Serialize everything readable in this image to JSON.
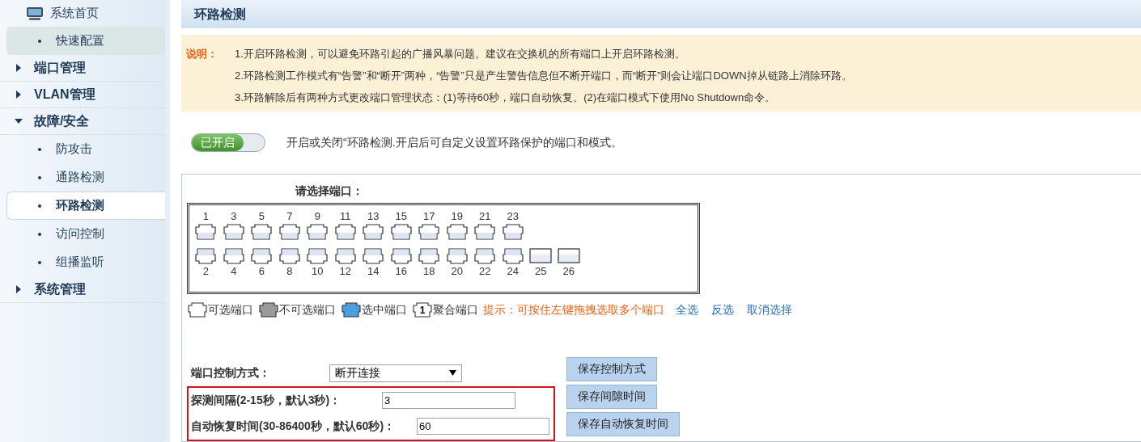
{
  "sidebar": {
    "items": [
      {
        "kind": "home",
        "label": "系统首页"
      },
      {
        "kind": "item",
        "label": "快速配置",
        "selected": false,
        "highlighted": true
      },
      {
        "kind": "group",
        "label": "端口管理",
        "expanded": false
      },
      {
        "kind": "group",
        "label": "VLAN管理",
        "expanded": false
      },
      {
        "kind": "group",
        "label": "故障/安全",
        "expanded": true,
        "children": [
          {
            "kind": "item",
            "label": "防攻击",
            "selected": false,
            "highlighted": false
          },
          {
            "kind": "item",
            "label": "通路检测",
            "selected": false,
            "highlighted": false
          },
          {
            "kind": "item",
            "label": "环路检测",
            "selected": true,
            "highlighted": false
          },
          {
            "kind": "item",
            "label": "访问控制",
            "selected": false,
            "highlighted": false
          },
          {
            "kind": "item",
            "label": "组播监听",
            "selected": false,
            "highlighted": false
          }
        ]
      },
      {
        "kind": "group",
        "label": "系统管理",
        "expanded": false
      }
    ]
  },
  "page_title": "环路检测",
  "note": {
    "label": "说明：",
    "lines": [
      "1.开启环路检测，可以避免环路引起的广播风暴问题。建议在交换机的所有端口上开启环路检测。",
      "2.环路检测工作模式有“告警”和“断开”两种，“告警”只是产生警告信息但不断开端口，而“断开”则会让端口DOWN掉从链路上消除环路。",
      "3.环路解除后有两种方式更改端口管理状态：(1)等待60秒，端口自动恢复。(2)在端口模式下使用No Shutdown命令。"
    ]
  },
  "toggle": {
    "label": "已开启",
    "on": true,
    "description": "开启或关闭“环路检测.开启后可自定义设置环路保护的端口和模式。"
  },
  "port_panel": {
    "title": "请选择端口：",
    "top_row": [
      {
        "label": "1",
        "kind": "rj45"
      },
      {
        "label": "3",
        "kind": "rj45"
      },
      {
        "label": "5",
        "kind": "rj45"
      },
      {
        "label": "7",
        "kind": "rj45"
      },
      {
        "label": "9",
        "kind": "rj45"
      },
      {
        "label": "11",
        "kind": "rj45"
      },
      {
        "label": "13",
        "kind": "rj45"
      },
      {
        "label": "15",
        "kind": "rj45"
      },
      {
        "label": "17",
        "kind": "rj45"
      },
      {
        "label": "19",
        "kind": "rj45"
      },
      {
        "label": "21",
        "kind": "rj45"
      },
      {
        "label": "23",
        "kind": "rj45"
      }
    ],
    "bottom_row": [
      {
        "label": "2",
        "kind": "rj45"
      },
      {
        "label": "4",
        "kind": "rj45"
      },
      {
        "label": "6",
        "kind": "rj45"
      },
      {
        "label": "8",
        "kind": "rj45"
      },
      {
        "label": "10",
        "kind": "rj45"
      },
      {
        "label": "12",
        "kind": "rj45"
      },
      {
        "label": "14",
        "kind": "rj45"
      },
      {
        "label": "16",
        "kind": "rj45"
      },
      {
        "label": "18",
        "kind": "rj45"
      },
      {
        "label": "20",
        "kind": "rj45"
      },
      {
        "label": "22",
        "kind": "rj45"
      },
      {
        "label": "24",
        "kind": "rj45"
      },
      {
        "label": "25",
        "kind": "sfp"
      },
      {
        "label": "26",
        "kind": "sfp"
      }
    ],
    "legend": [
      {
        "kind": "available",
        "label": "可选端口"
      },
      {
        "kind": "unavailable",
        "label": "不可选端口"
      },
      {
        "kind": "selected",
        "label": "选中端口"
      },
      {
        "kind": "aggregate",
        "number": "1",
        "label": "聚合端口"
      }
    ],
    "hint": "提示：可按住左键拖拽选取多个端口",
    "links": [
      "全选",
      "反选",
      "取消选择"
    ]
  },
  "form": {
    "rows": [
      {
        "kind": "select",
        "label": "端口控制方式：",
        "value": "断开连接",
        "button": "保存控制方式",
        "boxed": false
      },
      {
        "kind": "input",
        "label": "探测间隔(2-15秒，默认3秒)：",
        "value": "3",
        "button": "保存间隙时间",
        "boxed": true
      },
      {
        "kind": "input",
        "label": "自动恢复时间(30-86400秒，默认60秒)：",
        "value": "60",
        "button": "保存自动恢复时间",
        "boxed": true
      }
    ]
  }
}
